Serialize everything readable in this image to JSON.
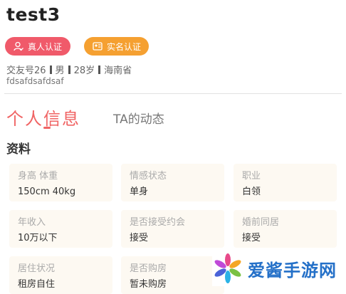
{
  "profile": {
    "name": "test3",
    "badges": [
      {
        "label": "真人认证",
        "color": "#f05a6a",
        "icon": "person-verify-icon"
      },
      {
        "label": "实名认证",
        "color": "#f5a031",
        "icon": "id-card-icon"
      }
    ],
    "meta": {
      "friend_id": "交友号26",
      "gender": "男",
      "age": "28岁",
      "province": "海南省"
    },
    "signature": "fdsafdsafdsaf"
  },
  "tabs": [
    {
      "label": "个人信息",
      "active": true
    },
    {
      "label": "TA的动态",
      "active": false
    }
  ],
  "section_title": "资料",
  "info_cards": [
    {
      "label": "身高 体重",
      "value": "150cm 40kg"
    },
    {
      "label": "情感状态",
      "value": "单身"
    },
    {
      "label": "职业",
      "value": "白领"
    },
    {
      "label": "年收入",
      "value": "10万以下"
    },
    {
      "label": "是否接受约会",
      "value": "接受"
    },
    {
      "label": "婚前同居",
      "value": "接受"
    },
    {
      "label": "居住状况",
      "value": "租房自住"
    },
    {
      "label": "是否购房",
      "value": "暂未购房"
    }
  ],
  "watermark": {
    "text": "爱酱手游网",
    "accent": "#2470c8"
  },
  "colors": {
    "accent": "#f06464",
    "card_bg": "#fdf9f2"
  }
}
